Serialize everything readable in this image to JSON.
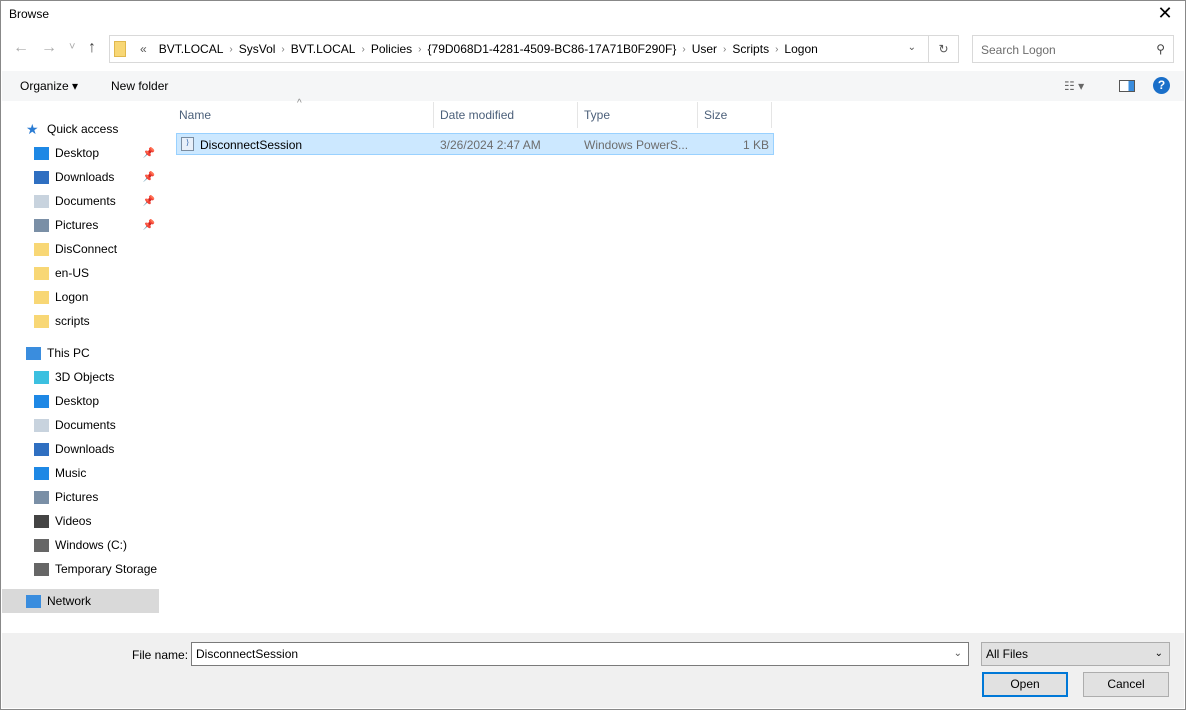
{
  "window": {
    "title": "Browse",
    "close_glyph": "✕"
  },
  "nav": {
    "back": "←",
    "forward": "→",
    "recent": "˅",
    "up": "↑",
    "breadcrumbs": [
      "«",
      "BVT.LOCAL",
      "SysVol",
      "BVT.LOCAL",
      "Policies",
      "{79D068D1-4281-4509-BC86-17A71B0F290F}",
      "User",
      "Scripts",
      "Logon"
    ],
    "search_placeholder": "Search Logon"
  },
  "toolbar": {
    "organize": "Organize ▾",
    "new_folder": "New folder",
    "help": "?"
  },
  "sidebar": {
    "items": [
      {
        "label": "Quick access",
        "icon": "star-icon",
        "color": "#2b7cd3"
      },
      {
        "label": "Desktop",
        "icon": "desktop-icon",
        "color": "#1e88e5",
        "pinned": true
      },
      {
        "label": "Downloads",
        "icon": "download-icon",
        "color": "#2f6fc1",
        "pinned": true
      },
      {
        "label": "Documents",
        "icon": "document-icon",
        "color": "#c8d3de",
        "pinned": true
      },
      {
        "label": "Pictures",
        "icon": "pictures-icon",
        "color": "#7a8fa6",
        "pinned": true
      },
      {
        "label": "DisConnect",
        "icon": "folder-icon",
        "color": "#f8d775"
      },
      {
        "label": "en-US",
        "icon": "folder-icon",
        "color": "#f8d775"
      },
      {
        "label": "Logon",
        "icon": "folder-icon",
        "color": "#f8d775"
      },
      {
        "label": "scripts",
        "icon": "folder-icon",
        "color": "#f8d775"
      },
      {
        "label": "This PC",
        "icon": "computer-icon",
        "color": "#3a8dde"
      },
      {
        "label": "3D Objects",
        "icon": "cube-icon",
        "color": "#3cc0e0"
      },
      {
        "label": "Desktop",
        "icon": "desktop-icon",
        "color": "#1e88e5"
      },
      {
        "label": "Documents",
        "icon": "document-icon",
        "color": "#c8d3de"
      },
      {
        "label": "Downloads",
        "icon": "download-icon",
        "color": "#2f6fc1"
      },
      {
        "label": "Music",
        "icon": "music-icon",
        "color": "#1e88e5"
      },
      {
        "label": "Pictures",
        "icon": "pictures-icon",
        "color": "#7a8fa6"
      },
      {
        "label": "Videos",
        "icon": "video-icon",
        "color": "#444"
      },
      {
        "label": "Windows (C:)",
        "icon": "drive-icon",
        "color": "#666"
      },
      {
        "label": "Temporary Storage",
        "icon": "drive-icon",
        "color": "#666"
      },
      {
        "label": "Network",
        "icon": "network-icon",
        "color": "#3a8dde",
        "selected": true
      }
    ]
  },
  "columns": [
    "Name",
    "Date modified",
    "Type",
    "Size"
  ],
  "files": [
    {
      "name": "DisconnectSession",
      "date": "3/26/2024 2:47 AM",
      "type": "Windows PowerS...",
      "size": "1 KB"
    }
  ],
  "footer": {
    "file_name_label": "File name:",
    "file_name": "DisconnectSession",
    "file_type": "All Files",
    "open": "Open",
    "cancel": "Cancel"
  }
}
